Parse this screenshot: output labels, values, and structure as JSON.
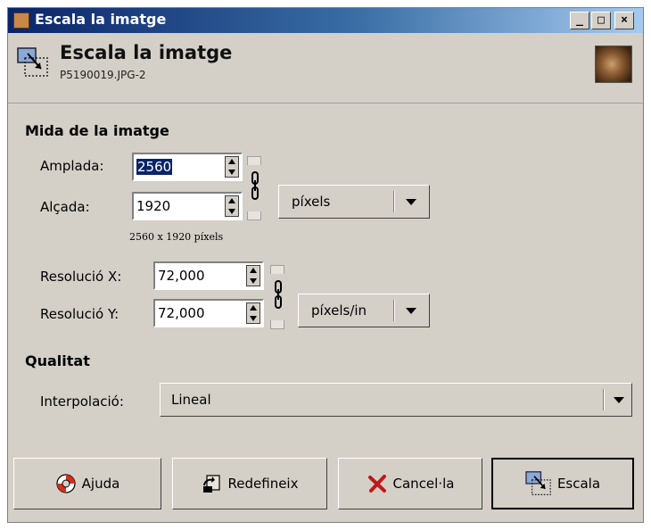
{
  "window": {
    "title": "Escala la imatge",
    "minimize_glyph": "_",
    "maximize_glyph": "□",
    "close_glyph": "×"
  },
  "header": {
    "title": "Escala la imatge",
    "subtitle": "P5190019.JPG-2"
  },
  "image_size": {
    "section_label": "Mida de la imatge",
    "width_label": "Amplada:",
    "width_value": "2560",
    "height_label": "Alçada:",
    "height_value": "1920",
    "unit": "píxels",
    "size_summary": "2560 x 1920 píxels",
    "res_x_label": "Resolució X:",
    "res_x_value": "72,000",
    "res_y_label": "Resolució Y:",
    "res_y_value": "72,000",
    "res_unit": "píxels/in"
  },
  "quality": {
    "section_label": "Qualitat",
    "interpolation_label": "Interpolació:",
    "interpolation_value": "Lineal"
  },
  "buttons": {
    "help": "Ajuda",
    "reset": "Redefineix",
    "cancel": "Cancel·la",
    "scale": "Escala"
  },
  "icons": {
    "app": "gimp-wilber-icon",
    "header": "scale-image-icon",
    "thumbnail": "image-thumbnail",
    "chain": "chain-link-icon",
    "help": "lifebuoy-icon",
    "reset": "reset-icon",
    "cancel": "cancel-x-icon",
    "scale": "scale-image-icon"
  },
  "colors": {
    "titlebar_start": "#0a246a",
    "titlebar_end": "#a6caf0",
    "dialog_bg": "#d4d0c8",
    "selection": "#0a246a"
  }
}
